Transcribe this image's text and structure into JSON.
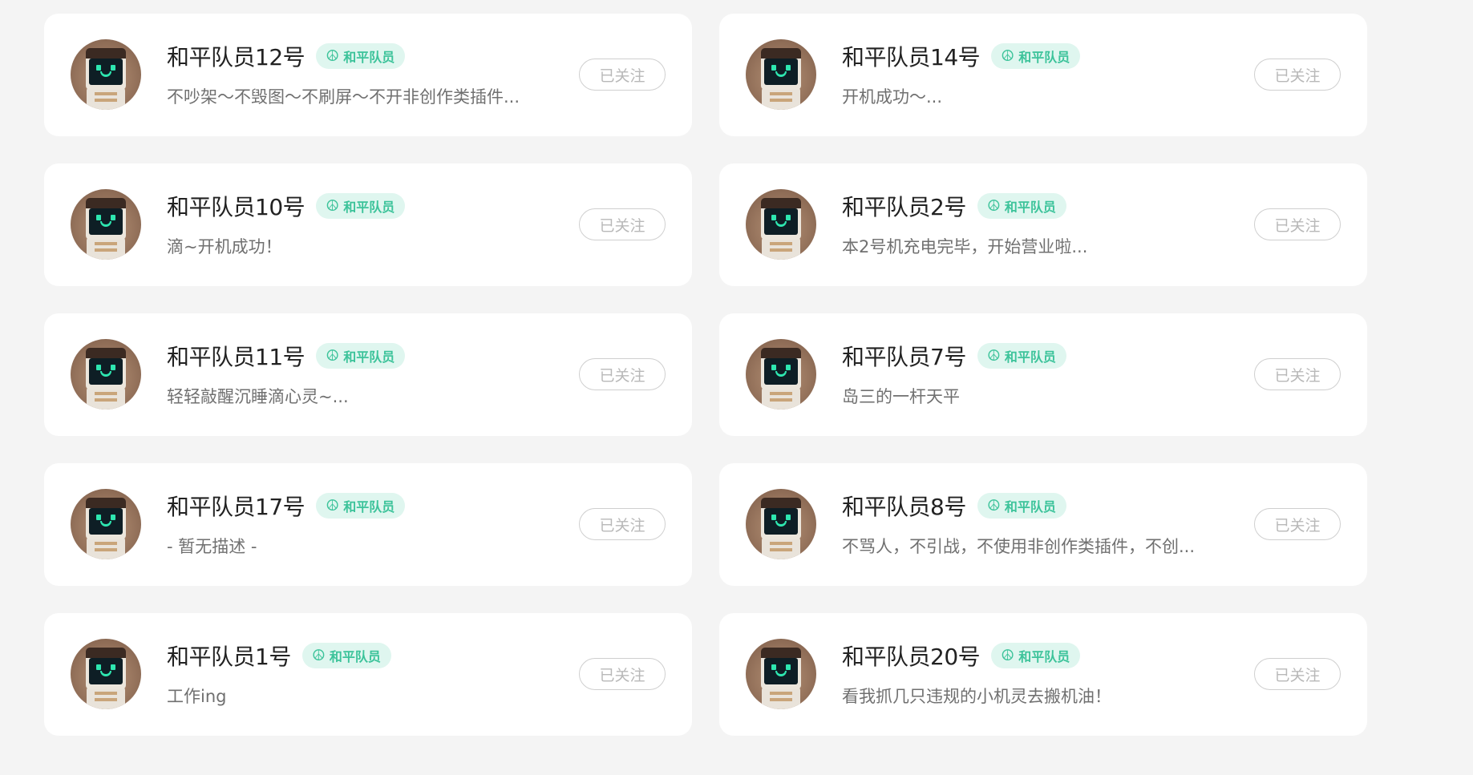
{
  "cards": [
    {
      "name": "和平队员12号",
      "badge": "和平队员",
      "desc": "不吵架～不毁图～不刷屏～不开非创作类插件...",
      "button": "已关注"
    },
    {
      "name": "和平队员14号",
      "badge": "和平队员",
      "desc": "开机成功～...",
      "button": "已关注"
    },
    {
      "name": "和平队员10号",
      "badge": "和平队员",
      "desc": "滴~开机成功！",
      "button": "已关注"
    },
    {
      "name": "和平队员2号",
      "badge": "和平队员",
      "desc": "本2号机充电完毕，开始营业啦...",
      "button": "已关注"
    },
    {
      "name": "和平队员11号",
      "badge": "和平队员",
      "desc": "轻轻敲醒沉睡滴心灵~...",
      "button": "已关注"
    },
    {
      "name": "和平队员7号",
      "badge": "和平队员",
      "desc": "岛三的一杆天平",
      "button": "已关注"
    },
    {
      "name": "和平队员17号",
      "badge": "和平队员",
      "desc": "- 暂无描述 -",
      "button": "已关注"
    },
    {
      "name": "和平队员8号",
      "badge": "和平队员",
      "desc": "不骂人，不引战，不使用非创作类插件，不创...",
      "button": "已关注"
    },
    {
      "name": "和平队员1号",
      "badge": "和平队员",
      "desc": "工作ing",
      "button": "已关注"
    },
    {
      "name": "和平队员20号",
      "badge": "和平队员",
      "desc": "看我抓几只违规的小机灵去搬机油！",
      "button": "已关注"
    }
  ],
  "colors": {
    "page_background": "#f4f4f4",
    "badge_background": "#dff6ef",
    "badge_text": "#3cc39a",
    "button_border": "#cfcfcf",
    "button_text": "#b8b8b8"
  },
  "icons": {
    "badge_icon": "peace-icon",
    "avatar": "robot-avatar"
  }
}
